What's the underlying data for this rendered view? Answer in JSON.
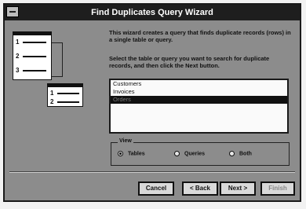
{
  "window": {
    "title": "Find Duplicates Query Wizard"
  },
  "illustration": {
    "table_rows": [
      "1",
      "2",
      "3"
    ],
    "result_rows": [
      "1",
      "2"
    ]
  },
  "instructions": {
    "intro": "This wizard creates a query that finds duplicate records (rows) in a single table or query.",
    "prompt": "Select the table or query you want to search for duplicate records, and then click the Next button."
  },
  "list": {
    "items": [
      {
        "label": "Customers",
        "selected": false
      },
      {
        "label": "Invoices",
        "selected": false
      },
      {
        "label": "Orders",
        "selected": true
      }
    ]
  },
  "view": {
    "label": "View",
    "options": [
      {
        "label": "Tables",
        "checked": true
      },
      {
        "label": "Queries",
        "checked": false
      },
      {
        "label": "Both",
        "checked": false
      }
    ]
  },
  "buttons": {
    "cancel": "Cancel",
    "back": "< Back",
    "next": "Next >",
    "finish": "Finish"
  }
}
